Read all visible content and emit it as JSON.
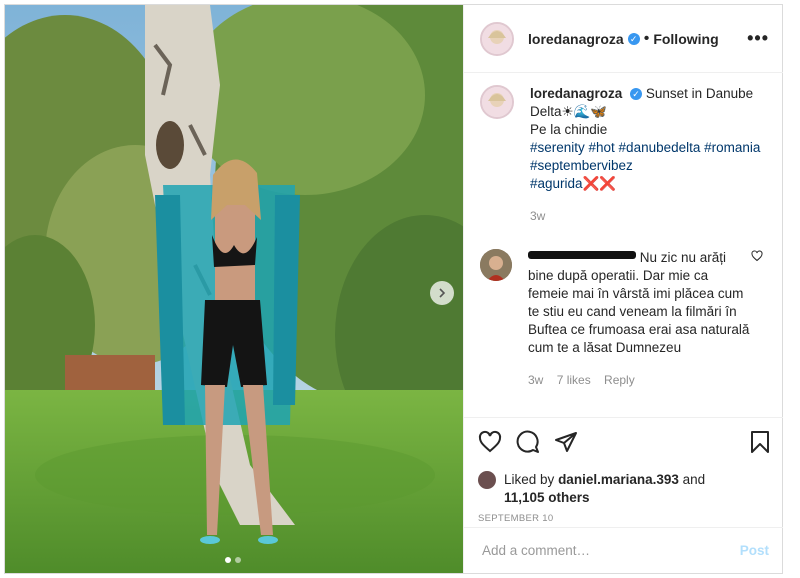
{
  "header": {
    "username": "loredanagroza",
    "separator": "•",
    "follow_status": "Following",
    "more_icon": "more-horizontal-icon"
  },
  "caption": {
    "username": "loredanagroza",
    "line1": "Sunset in Danube Delta",
    "line1_emojis": "☀🌊🦋",
    "line2": "Pe la chindie",
    "hashtags_row1": "#serenity #hot #danubedelta #romania",
    "hashtags_row2": "#septembervibez",
    "hashtags_row3": "#agurida",
    "hashtags_row3_emojis": "❌❌",
    "age": "3w"
  },
  "comment": {
    "text": "Nu zic nu arăți bine după operatii. Dar mie ca femeie mai în vârstă imi plăcea cum te stiu eu cand veneam la filmări în Buftea ce frumoasa erai asa naturală cum te a lăsat Dumnezeu",
    "age": "3w",
    "likes": "7 likes",
    "reply": "Reply"
  },
  "actions": {
    "like_icon": "heart-icon",
    "comment_icon": "comment-icon",
    "share_icon": "share-icon",
    "save_icon": "bookmark-icon"
  },
  "likes": {
    "prefix": "Liked by",
    "user": "daniel.mariana.393",
    "and": "and",
    "others": "11,105 others"
  },
  "date": "SEPTEMBER 10",
  "add_comment": {
    "placeholder": "Add a comment…",
    "post_label": "Post"
  },
  "colors": {
    "verified": "#3897f0",
    "hashtag": "#00376b",
    "post_disabled": "#b2dffc",
    "meta": "#8e8e8e"
  }
}
